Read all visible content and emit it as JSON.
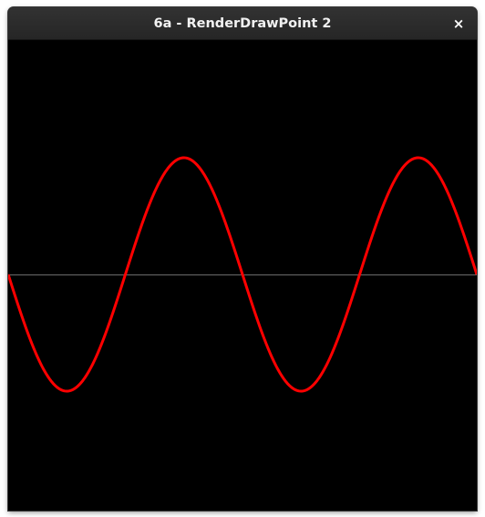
{
  "window": {
    "title": "6a - RenderDrawPoint 2",
    "close_glyph": "×"
  },
  "canvas": {
    "background": "#000000",
    "axis_color": "#6b6b6b",
    "curve_color": "#ff0000",
    "curve": {
      "function": "sine",
      "periods_visible": 2,
      "starts_with": "descending"
    }
  }
}
